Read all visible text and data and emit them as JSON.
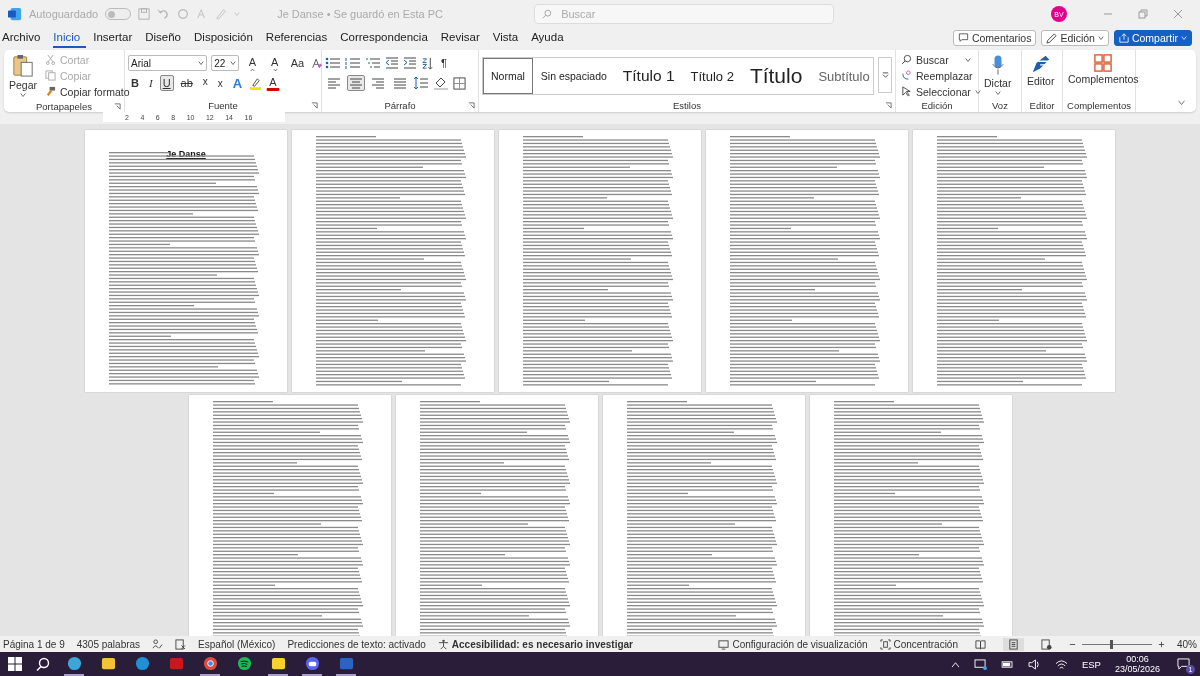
{
  "title_bar": {
    "autosave": {
      "label": "Autoguardado",
      "on": false
    },
    "document_title": "Je Danse • Se guardó en Esta PC",
    "search": {
      "placeholder": "Buscar"
    },
    "avatar": "BV"
  },
  "menu_tabs": [
    {
      "label": "Archivo",
      "selected": false
    },
    {
      "label": "Inicio",
      "selected": true
    },
    {
      "label": "Insertar",
      "selected": false
    },
    {
      "label": "Diseño",
      "selected": false
    },
    {
      "label": "Disposición",
      "selected": false
    },
    {
      "label": "Referencias",
      "selected": false
    },
    {
      "label": "Correspondencia",
      "selected": false
    },
    {
      "label": "Revisar",
      "selected": false
    },
    {
      "label": "Vista",
      "selected": false
    },
    {
      "label": "Ayuda",
      "selected": false
    }
  ],
  "top_actions": {
    "comments": "Comentarios",
    "editing": "Edición",
    "share": "Compartir"
  },
  "clipboard": {
    "paste": "Pegar",
    "cut": "Cortar",
    "copy": "Copiar",
    "format_painter": "Copiar formato",
    "group": "Portapapeles"
  },
  "font": {
    "name": "Arial",
    "size": "22",
    "grow": "A",
    "shrink": "A",
    "change_case": "Aa",
    "group": "Fuente",
    "format_buttons": [
      {
        "label": "B",
        "kind": "bold",
        "selected": false
      },
      {
        "label": "I",
        "kind": "italic",
        "selected": false
      },
      {
        "label": "U",
        "kind": "underline",
        "selected": true
      },
      {
        "label": "ab",
        "kind": "strike",
        "selected": false
      },
      {
        "label": "x",
        "kind": "sub",
        "selected": false
      },
      {
        "label": "x",
        "kind": "sup",
        "selected": false
      }
    ],
    "effects": "A",
    "font_color": "A"
  },
  "paragraph": {
    "pilcrow": "¶",
    "group": "Párrafo",
    "alignment": [
      {
        "kind": "left",
        "selected": false
      },
      {
        "kind": "center",
        "selected": true
      },
      {
        "kind": "right",
        "selected": false
      },
      {
        "kind": "justify",
        "selected": false
      }
    ]
  },
  "styles": {
    "group": "Estilos",
    "items": [
      {
        "label": "Normal",
        "kind": "normal",
        "selected": true
      },
      {
        "label": "Sin espaciado",
        "kind": "normal",
        "selected": false
      },
      {
        "label": "Título 1",
        "kind": "h1",
        "selected": false
      },
      {
        "label": "Título 2",
        "kind": "h2",
        "selected": false
      },
      {
        "label": "Título",
        "kind": "title",
        "selected": false
      },
      {
        "label": "Subtítulo",
        "kind": "subtitle",
        "selected": false
      }
    ]
  },
  "editing": {
    "group": "Edición",
    "find": "Buscar",
    "replace": "Reemplazar",
    "select": "Seleccionar"
  },
  "voice": {
    "group": "Voz",
    "dictate": "Dictar"
  },
  "editor": {
    "group": "Editor",
    "label": "Editor"
  },
  "addins": {
    "group": "Complementos",
    "label": "Complementos"
  },
  "ruler": [
    "2",
    "4",
    "6",
    "8",
    "10",
    "12",
    "14",
    "16"
  ],
  "page_rows": [
    [
      {
        "kind": "title_page",
        "heading": "Je Danse"
      },
      {
        "kind": "text_page"
      },
      {
        "kind": "text_page"
      },
      {
        "kind": "text_page"
      },
      {
        "kind": "text_page"
      }
    ],
    [
      {
        "kind": "text_page"
      },
      {
        "kind": "text_page"
      },
      {
        "kind": "text_page"
      },
      {
        "kind": "text_page"
      }
    ]
  ],
  "status_bar": {
    "page": "Página 1 de 9",
    "words": "4305 palabras",
    "language": "Español (México)",
    "predictions": "Predicciones de texto: activado",
    "accessibility": "Accesibilidad: es necesario investigar",
    "display_settings": "Configuración de visualización",
    "focus": "Concentración",
    "zoom": {
      "level": 0.4,
      "reading": "40%"
    }
  },
  "taskbar": {
    "apps": [
      {
        "kind": "edge-beta",
        "running": true
      },
      {
        "kind": "folder",
        "running": false
      },
      {
        "kind": "edge",
        "running": false
      },
      {
        "kind": "pdf",
        "running": false
      },
      {
        "kind": "chrome",
        "running": true
      },
      {
        "kind": "spotify",
        "running": false
      },
      {
        "kind": "notes",
        "running": true
      },
      {
        "kind": "discord",
        "running": true
      },
      {
        "kind": "word",
        "running": true
      }
    ],
    "language": "ESP",
    "time": "00:06",
    "date": "23/05/2026",
    "notifications": "1"
  }
}
